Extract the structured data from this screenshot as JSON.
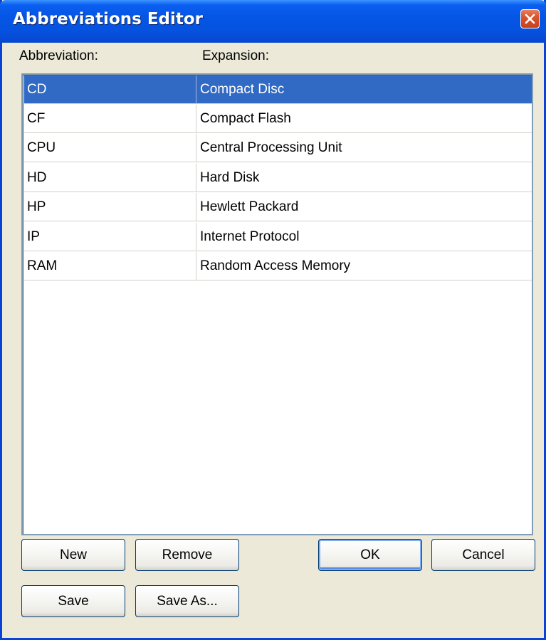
{
  "window": {
    "title": "Abbreviations Editor"
  },
  "columns": {
    "abbreviation": "Abbreviation:",
    "expansion": "Expansion:"
  },
  "rows": [
    {
      "abbr": "CD",
      "exp": "Compact Disc",
      "selected": true
    },
    {
      "abbr": "CF",
      "exp": "Compact Flash",
      "selected": false
    },
    {
      "abbr": "CPU",
      "exp": "Central Processing Unit",
      "selected": false
    },
    {
      "abbr": "HD",
      "exp": "Hard Disk",
      "selected": false
    },
    {
      "abbr": "HP",
      "exp": "Hewlett Packard",
      "selected": false
    },
    {
      "abbr": "IP",
      "exp": "Internet Protocol",
      "selected": false
    },
    {
      "abbr": "RAM",
      "exp": "Random Access Memory",
      "selected": false
    }
  ],
  "buttons": {
    "new": "New",
    "remove": "Remove",
    "ok": "OK",
    "cancel": "Cancel",
    "save": "Save",
    "save_as": "Save As..."
  },
  "colors": {
    "title_bar": "#0554e3",
    "selection": "#316ac5",
    "dialog_bg": "#ece9d8",
    "close_button": "#d9542c"
  },
  "icons": {
    "close": "close-icon"
  }
}
